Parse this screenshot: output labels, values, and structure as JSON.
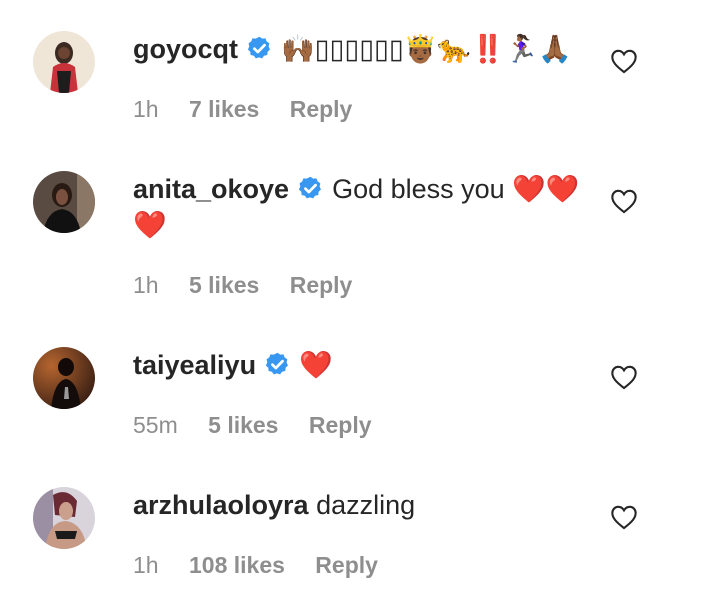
{
  "comments": [
    {
      "username": "goyocqt",
      "verified": true,
      "text": "🙌🏾▯▯▯▯▯▯🤴🏾🐆‼️🏃🏾‍♀️🙏🏾",
      "time": "1h",
      "likes": "7 likes",
      "reply": "Reply",
      "like_icon": "heart-outline-icon"
    },
    {
      "username": "anita_okoye",
      "verified": true,
      "text": "God bless you ❤️❤️ ❤️",
      "time": "1h",
      "likes": "5 likes",
      "reply": "Reply",
      "like_icon": "heart-outline-icon"
    },
    {
      "username": "taiyealiyu",
      "verified": true,
      "text": "❤️",
      "time": "55m",
      "likes": "5 likes",
      "reply": "Reply",
      "like_icon": "heart-outline-icon"
    },
    {
      "username": "arzhulaoloyra",
      "verified": false,
      "text": "dazzling",
      "time": "1h",
      "likes": "108 likes",
      "reply": "Reply",
      "like_icon": "heart-outline-icon"
    }
  ],
  "colors": {
    "text": "#262626",
    "meta": "#8e8e8e",
    "verified": "#3897f0",
    "heart": "#e0152b"
  }
}
